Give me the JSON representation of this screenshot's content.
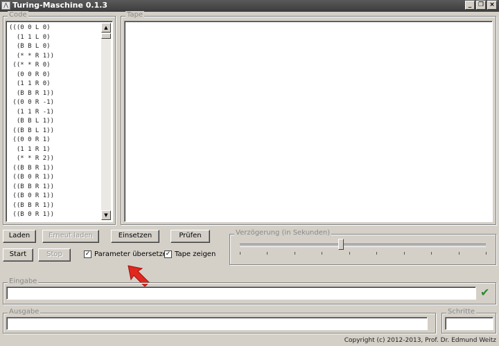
{
  "window": {
    "title": "Turing-Maschine 0.1.3",
    "icon": "app-icon",
    "controls": [
      "_",
      "×"
    ]
  },
  "code": {
    "legend": "Code",
    "lines": [
      "(((0 0 L 0)",
      "  (1 1 L 0)",
      "  (B B L 0)",
      "  (* * R 1))",
      " ((* * R 0)",
      "  (0 0 R 0)",
      "  (1 1 R 0)",
      "  (B B R 1))",
      " ((0 0 R -1)",
      "  (1 1 R -1)",
      "  (B B L 1))",
      " ((B B L 1))",
      " ((0 0 R 1)",
      "  (1 1 R 1)",
      "  (* * R 2))",
      " ((B B R 1))",
      " ((B 0 R 1))",
      " ((B B R 1))",
      " ((B 0 R 1))",
      " ((B B R 1))",
      " ((B 0 R 1))"
    ]
  },
  "tape": {
    "legend": "Tape"
  },
  "buttons": {
    "laden": "Laden",
    "erneut_laden": "Erneut laden",
    "einsetzen": "Einsetzen",
    "pruefen": "Prüfen",
    "start": "Start",
    "stop": "Stop"
  },
  "checkboxes": {
    "parameter_uebersetzen": {
      "label": "Parameter übersetzen",
      "checked": true
    },
    "tape_zeigen": {
      "label": "Tape zeigen",
      "checked": true
    }
  },
  "delay": {
    "legend": "Verzögerung (in Sekunden)",
    "value_fraction": 0.41
  },
  "input": {
    "legend": "Eingabe",
    "value": "",
    "confirm_icon": "checkmark-icon",
    "confirm_color": "#2e8b2e"
  },
  "output": {
    "legend": "Ausgabe",
    "value": ""
  },
  "steps": {
    "legend": "Schritte",
    "value": ""
  },
  "annotation": {
    "icon": "red-arrow-icon",
    "color": "#e0281e"
  },
  "footer": {
    "copyright": "Copyright (c) 2012-2013, Prof. Dr. Edmund Weitz"
  }
}
